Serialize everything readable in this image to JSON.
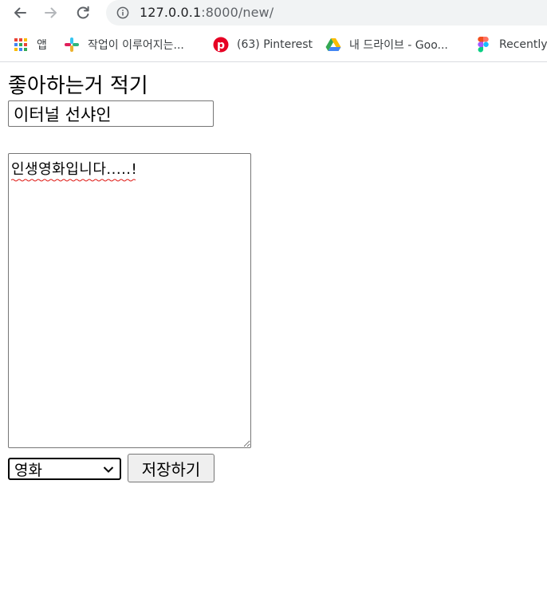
{
  "browser": {
    "url_host": "127.0.0.1",
    "url_path": ":8000/new/",
    "back_icon": "arrow-left-icon",
    "forward_icon": "arrow-right-icon",
    "reload_icon": "reload-icon",
    "info_icon": "info-icon"
  },
  "bookmarks": [
    {
      "label": "앱",
      "icon": "apps-grid-icon"
    },
    {
      "label": "작업이 이루어지는...",
      "icon": "slack-icon"
    },
    {
      "label": "(63) Pinterest",
      "icon": "pinterest-icon"
    },
    {
      "label": "내 드라이브 - Goo...",
      "icon": "google-drive-icon"
    },
    {
      "label": "Recently",
      "icon": "figma-icon"
    }
  ],
  "form": {
    "heading": "좋아하는거 적기",
    "title_value": "이터널 선샤인",
    "content_value": "인생영화입니다.....!",
    "category_selected": "영화",
    "category_options": [
      "영화"
    ],
    "submit_label": "저장하기"
  },
  "colors": {
    "omnibox_bg": "#f1f3f4",
    "button_bg": "#efefef",
    "spellcheck": "#e0201b"
  }
}
